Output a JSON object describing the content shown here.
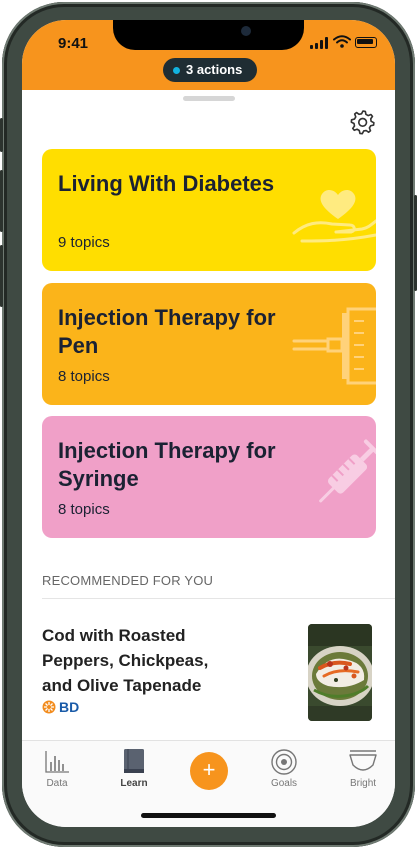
{
  "status_bar": {
    "time": "9:41"
  },
  "actions_pill": {
    "label": "3 actions"
  },
  "cards": [
    {
      "title": "Living With Diabetes",
      "subtitle": "9 topics",
      "color": "#ffde00",
      "icon": "hand-heart-icon"
    },
    {
      "title": "Injection Therapy for Pen",
      "subtitle": "8 topics",
      "color": "#fbb41a",
      "icon": "insulin-pen-icon"
    },
    {
      "title": "Injection Therapy for Syringe",
      "subtitle": "8 topics",
      "color": "#f0a0c8",
      "icon": "syringe-icon"
    }
  ],
  "recommended": {
    "section_label": "RECOMMENDED FOR YOU",
    "title": "Cod with Roasted Peppers, Chickpeas, and Olive Tapenade",
    "brand": "BD"
  },
  "tabbar": {
    "tabs": [
      {
        "label": "Data",
        "icon": "bar-chart-icon"
      },
      {
        "label": "Learn",
        "icon": "book-icon",
        "active": true
      },
      {
        "label": "+",
        "icon": "plus-icon"
      },
      {
        "label": "Goals",
        "icon": "target-icon"
      },
      {
        "label": "Bright",
        "icon": "bright-icon"
      }
    ]
  },
  "colors": {
    "accent": "#f7941d",
    "text_dark": "#1b2233"
  }
}
